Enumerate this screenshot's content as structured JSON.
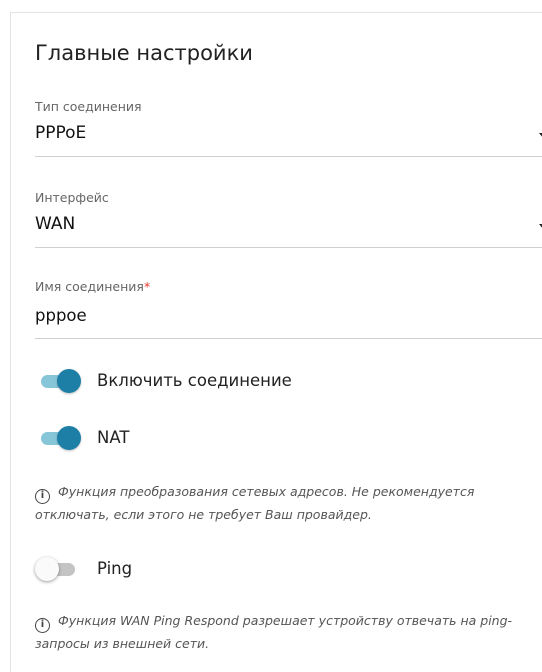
{
  "section": {
    "title": "Главные настройки"
  },
  "connection_type": {
    "label": "Тип соединения",
    "value": "PPPoE",
    "icon": "chevron-down-icon"
  },
  "interface": {
    "label": "Интерфейс",
    "value": "WAN",
    "icon": "chevron-down-icon"
  },
  "connection_name": {
    "label": "Имя соединения",
    "required_mark": "*",
    "value": "pppoe"
  },
  "toggles": [
    {
      "label": "Включить соединение",
      "state": "on"
    },
    {
      "label": "NAT",
      "state": "on"
    },
    {
      "label": "Ping",
      "state": "off"
    }
  ],
  "hints": {
    "nat": "Функция преобразования сетевых адресов. Не рекомендуется отключать, если этого не требует Ваш провайдер.",
    "ping": "Функция WAN Ping Respond разрешает устройству отвечать на ping-запросы из внешней сети.",
    "icon": "info-icon",
    "icon_glyph": "i"
  },
  "colors": {
    "switch_on_knob": "#1e7fa6",
    "switch_on_track": "#87c5d9",
    "required": "#e53935"
  }
}
